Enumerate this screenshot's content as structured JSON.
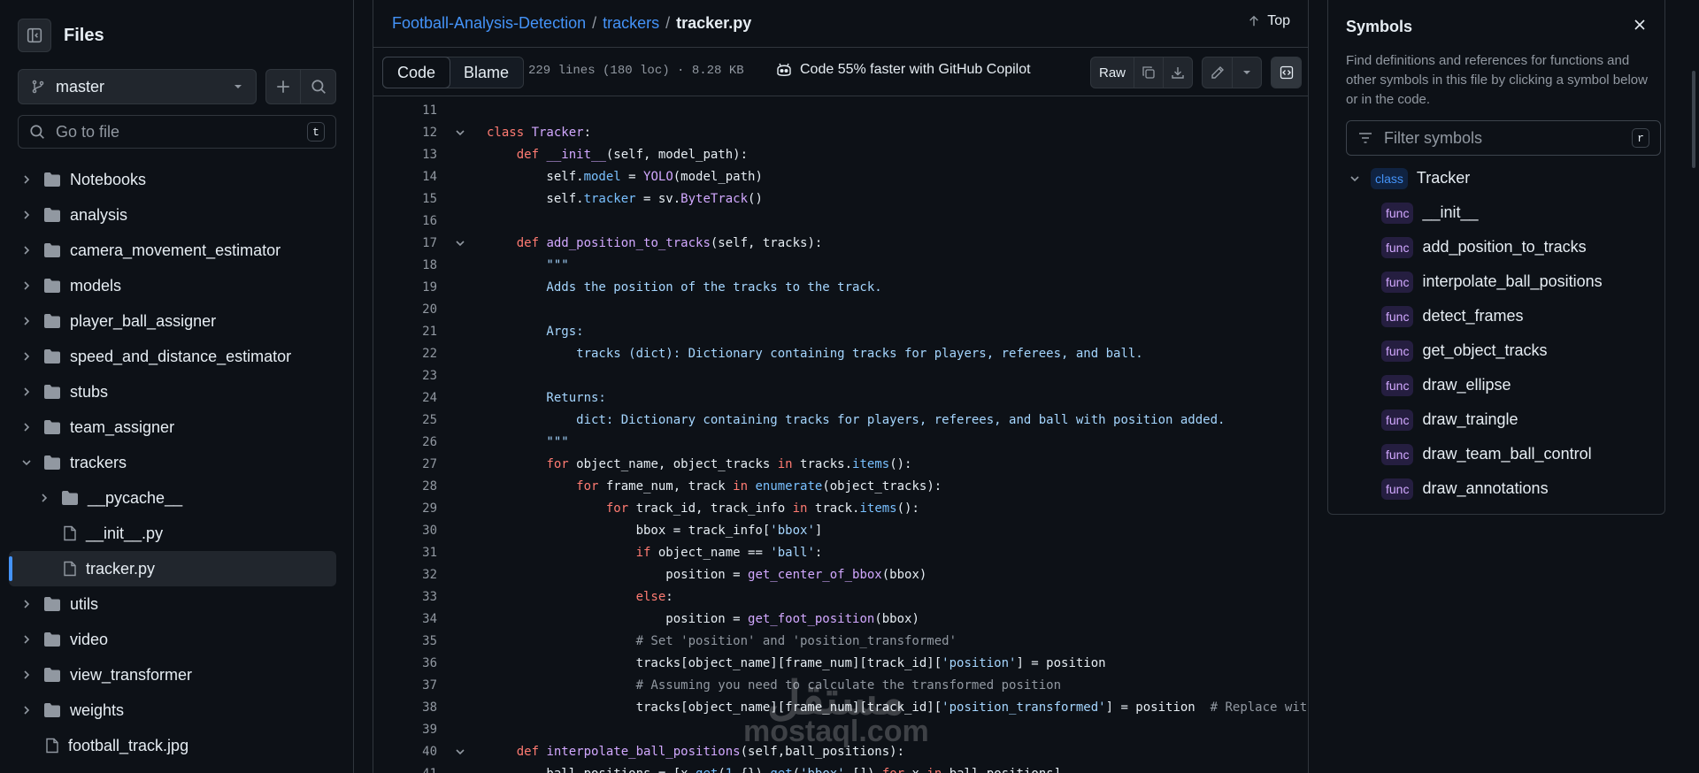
{
  "sidebar": {
    "title": "Files",
    "branch": "master",
    "goto_placeholder": "Go to file",
    "goto_key": "t",
    "items": [
      {
        "label": "Notebooks",
        "type": "folder",
        "depth": 0,
        "expanded": false,
        "active": false
      },
      {
        "label": "analysis",
        "type": "folder",
        "depth": 0,
        "expanded": false,
        "active": false
      },
      {
        "label": "camera_movement_estimator",
        "type": "folder",
        "depth": 0,
        "expanded": false,
        "active": false
      },
      {
        "label": "models",
        "type": "folder",
        "depth": 0,
        "expanded": false,
        "active": false
      },
      {
        "label": "player_ball_assigner",
        "type": "folder",
        "depth": 0,
        "expanded": false,
        "active": false
      },
      {
        "label": "speed_and_distance_estimator",
        "type": "folder",
        "depth": 0,
        "expanded": false,
        "active": false
      },
      {
        "label": "stubs",
        "type": "folder",
        "depth": 0,
        "expanded": false,
        "active": false
      },
      {
        "label": "team_assigner",
        "type": "folder",
        "depth": 0,
        "expanded": false,
        "active": false
      },
      {
        "label": "trackers",
        "type": "folder",
        "depth": 0,
        "expanded": true,
        "active": false
      },
      {
        "label": "__pycache__",
        "type": "folder",
        "depth": 1,
        "expanded": false,
        "active": false
      },
      {
        "label": "__init__.py",
        "type": "file",
        "depth": 1,
        "expanded": false,
        "active": false
      },
      {
        "label": "tracker.py",
        "type": "file",
        "depth": 1,
        "expanded": false,
        "active": true
      },
      {
        "label": "utils",
        "type": "folder",
        "depth": 0,
        "expanded": false,
        "active": false
      },
      {
        "label": "video",
        "type": "folder",
        "depth": 0,
        "expanded": false,
        "active": false
      },
      {
        "label": "view_transformer",
        "type": "folder",
        "depth": 0,
        "expanded": false,
        "active": false
      },
      {
        "label": "weights",
        "type": "folder",
        "depth": 0,
        "expanded": false,
        "active": false
      },
      {
        "label": "football_track.jpg",
        "type": "file",
        "depth": 0,
        "expanded": false,
        "active": false
      }
    ]
  },
  "header": {
    "repo": "Football-Analysis-Detection",
    "folder": "trackers",
    "file": "tracker.py",
    "sep": "/",
    "top_label": "Top"
  },
  "toolbar": {
    "code_tab": "Code",
    "blame_tab": "Blame",
    "meta": "229 lines (180 loc) · 8.28 KB",
    "copilot": "Code 55% faster with GitHub Copilot",
    "raw_label": "Raw"
  },
  "code_lines": [
    {
      "n": "11",
      "fold": false,
      "tokens": []
    },
    {
      "n": "12",
      "fold": true,
      "tokens": [
        [
          "k",
          "class "
        ],
        [
          "f",
          "Tracker"
        ],
        [
          "t",
          ":"
        ]
      ]
    },
    {
      "n": "13",
      "fold": false,
      "tokens": [
        [
          "t",
          "    "
        ],
        [
          "k",
          "def "
        ],
        [
          "f",
          "__init__"
        ],
        [
          "t",
          "(self, model_path):"
        ]
      ]
    },
    {
      "n": "14",
      "fold": false,
      "tokens": [
        [
          "t",
          "        self."
        ],
        [
          "c",
          "model"
        ],
        [
          "t",
          " = "
        ],
        [
          "f",
          "YOLO"
        ],
        [
          "t",
          "(model_path)"
        ]
      ]
    },
    {
      "n": "15",
      "fold": false,
      "tokens": [
        [
          "t",
          "        self."
        ],
        [
          "c",
          "tracker"
        ],
        [
          "t",
          " = sv."
        ],
        [
          "f",
          "ByteTrack"
        ],
        [
          "t",
          "()"
        ]
      ]
    },
    {
      "n": "16",
      "fold": false,
      "tokens": []
    },
    {
      "n": "17",
      "fold": true,
      "tokens": [
        [
          "t",
          "    "
        ],
        [
          "k",
          "def "
        ],
        [
          "f",
          "add_position_to_tracks"
        ],
        [
          "t",
          "(self, tracks):"
        ]
      ]
    },
    {
      "n": "18",
      "fold": false,
      "tokens": [
        [
          "s",
          "        \"\"\""
        ]
      ]
    },
    {
      "n": "19",
      "fold": false,
      "tokens": [
        [
          "s",
          "        Adds the position of the tracks to the track."
        ]
      ]
    },
    {
      "n": "20",
      "fold": false,
      "tokens": []
    },
    {
      "n": "21",
      "fold": false,
      "tokens": [
        [
          "s",
          "        Args:"
        ]
      ]
    },
    {
      "n": "22",
      "fold": false,
      "tokens": [
        [
          "s",
          "            tracks (dict): Dictionary containing tracks for players, referees, and ball."
        ]
      ]
    },
    {
      "n": "23",
      "fold": false,
      "tokens": []
    },
    {
      "n": "24",
      "fold": false,
      "tokens": [
        [
          "s",
          "        Returns:"
        ]
      ]
    },
    {
      "n": "25",
      "fold": false,
      "tokens": [
        [
          "s",
          "            dict: Dictionary containing tracks for players, referees, and ball with position added."
        ]
      ]
    },
    {
      "n": "26",
      "fold": false,
      "tokens": [
        [
          "s",
          "        \"\"\""
        ]
      ]
    },
    {
      "n": "27",
      "fold": false,
      "tokens": [
        [
          "t",
          "        "
        ],
        [
          "k",
          "for "
        ],
        [
          "t",
          "object_name, object_tracks "
        ],
        [
          "k",
          "in "
        ],
        [
          "t",
          "tracks."
        ],
        [
          "c",
          "items"
        ],
        [
          "t",
          "():"
        ]
      ]
    },
    {
      "n": "28",
      "fold": false,
      "tokens": [
        [
          "t",
          "            "
        ],
        [
          "k",
          "for "
        ],
        [
          "t",
          "frame_num, track "
        ],
        [
          "k",
          "in "
        ],
        [
          "c",
          "enumerate"
        ],
        [
          "t",
          "(object_tracks):"
        ]
      ]
    },
    {
      "n": "29",
      "fold": false,
      "tokens": [
        [
          "t",
          "                "
        ],
        [
          "k",
          "for "
        ],
        [
          "t",
          "track_id, track_info "
        ],
        [
          "k",
          "in "
        ],
        [
          "t",
          "track."
        ],
        [
          "c",
          "items"
        ],
        [
          "t",
          "():"
        ]
      ]
    },
    {
      "n": "30",
      "fold": false,
      "tokens": [
        [
          "t",
          "                    bbox = track_info["
        ],
        [
          "s",
          "'bbox'"
        ],
        [
          "t",
          "]"
        ]
      ]
    },
    {
      "n": "31",
      "fold": false,
      "tokens": [
        [
          "t",
          "                    "
        ],
        [
          "k",
          "if "
        ],
        [
          "t",
          "object_name == "
        ],
        [
          "s",
          "'ball'"
        ],
        [
          "t",
          ":"
        ]
      ]
    },
    {
      "n": "32",
      "fold": false,
      "tokens": [
        [
          "t",
          "                        position = "
        ],
        [
          "f",
          "get_center_of_bbox"
        ],
        [
          "t",
          "(bbox)"
        ]
      ]
    },
    {
      "n": "33",
      "fold": false,
      "tokens": [
        [
          "t",
          "                    "
        ],
        [
          "k",
          "else"
        ],
        [
          "t",
          ":"
        ]
      ]
    },
    {
      "n": "34",
      "fold": false,
      "tokens": [
        [
          "t",
          "                        position = "
        ],
        [
          "f",
          "get_foot_position"
        ],
        [
          "t",
          "(bbox)"
        ]
      ]
    },
    {
      "n": "35",
      "fold": false,
      "tokens": [
        [
          "cm",
          "                    # Set 'position' and 'position_transformed'"
        ]
      ]
    },
    {
      "n": "36",
      "fold": false,
      "tokens": [
        [
          "t",
          "                    tracks[object_name][frame_num][track_id]["
        ],
        [
          "s",
          "'position'"
        ],
        [
          "t",
          "] = position"
        ]
      ]
    },
    {
      "n": "37",
      "fold": false,
      "tokens": [
        [
          "cm",
          "                    # Assuming you need to calculate the transformed position"
        ]
      ]
    },
    {
      "n": "38",
      "fold": false,
      "tokens": [
        [
          "t",
          "                    tracks[object_name][frame_num][track_id]["
        ],
        [
          "s",
          "'position_transformed'"
        ],
        [
          "t",
          "] = position  "
        ],
        [
          "cm",
          "# Replace with ac"
        ]
      ]
    },
    {
      "n": "39",
      "fold": false,
      "tokens": []
    },
    {
      "n": "40",
      "fold": true,
      "tokens": [
        [
          "t",
          "    "
        ],
        [
          "k",
          "def "
        ],
        [
          "f",
          "interpolate_ball_positions"
        ],
        [
          "t",
          "(self,ball_positions):"
        ]
      ]
    },
    {
      "n": "41",
      "fold": false,
      "tokens": [
        [
          "t",
          "        ball_positions = [x."
        ],
        [
          "c",
          "get"
        ],
        [
          "t",
          "("
        ],
        [
          "c",
          "1"
        ],
        [
          "t",
          ",{})."
        ],
        [
          "c",
          "get"
        ],
        [
          "t",
          "("
        ],
        [
          "s",
          "'bbox'"
        ],
        [
          "t",
          ",[]) "
        ],
        [
          "k",
          "for "
        ],
        [
          "t",
          "x "
        ],
        [
          "k",
          "in "
        ],
        [
          "t",
          "ball_positions]"
        ]
      ]
    }
  ],
  "symbols": {
    "title": "Symbols",
    "description": "Find definitions and references for functions and other symbols in this file by clicking a symbol below or in the code.",
    "filter_placeholder": "Filter symbols",
    "filter_key": "r",
    "items": [
      {
        "kind": "class",
        "name": "Tracker",
        "child": false
      },
      {
        "kind": "func",
        "name": "__init__",
        "child": true
      },
      {
        "kind": "func",
        "name": "add_position_to_tracks",
        "child": true
      },
      {
        "kind": "func",
        "name": "interpolate_ball_positions",
        "child": true
      },
      {
        "kind": "func",
        "name": "detect_frames",
        "child": true
      },
      {
        "kind": "func",
        "name": "get_object_tracks",
        "child": true
      },
      {
        "kind": "func",
        "name": "draw_ellipse",
        "child": true
      },
      {
        "kind": "func",
        "name": "draw_traingle",
        "child": true
      },
      {
        "kind": "func",
        "name": "draw_team_ball_control",
        "child": true
      },
      {
        "kind": "func",
        "name": "draw_annotations",
        "child": true
      }
    ]
  },
  "watermark": {
    "line1": "مستقل",
    "line2": "mostaql.com"
  },
  "colors": {
    "link": "#4493f8",
    "keyword": "#ff7b72",
    "function": "#d2a8ff",
    "constant": "#79c0ff",
    "string": "#a5d6ff"
  }
}
